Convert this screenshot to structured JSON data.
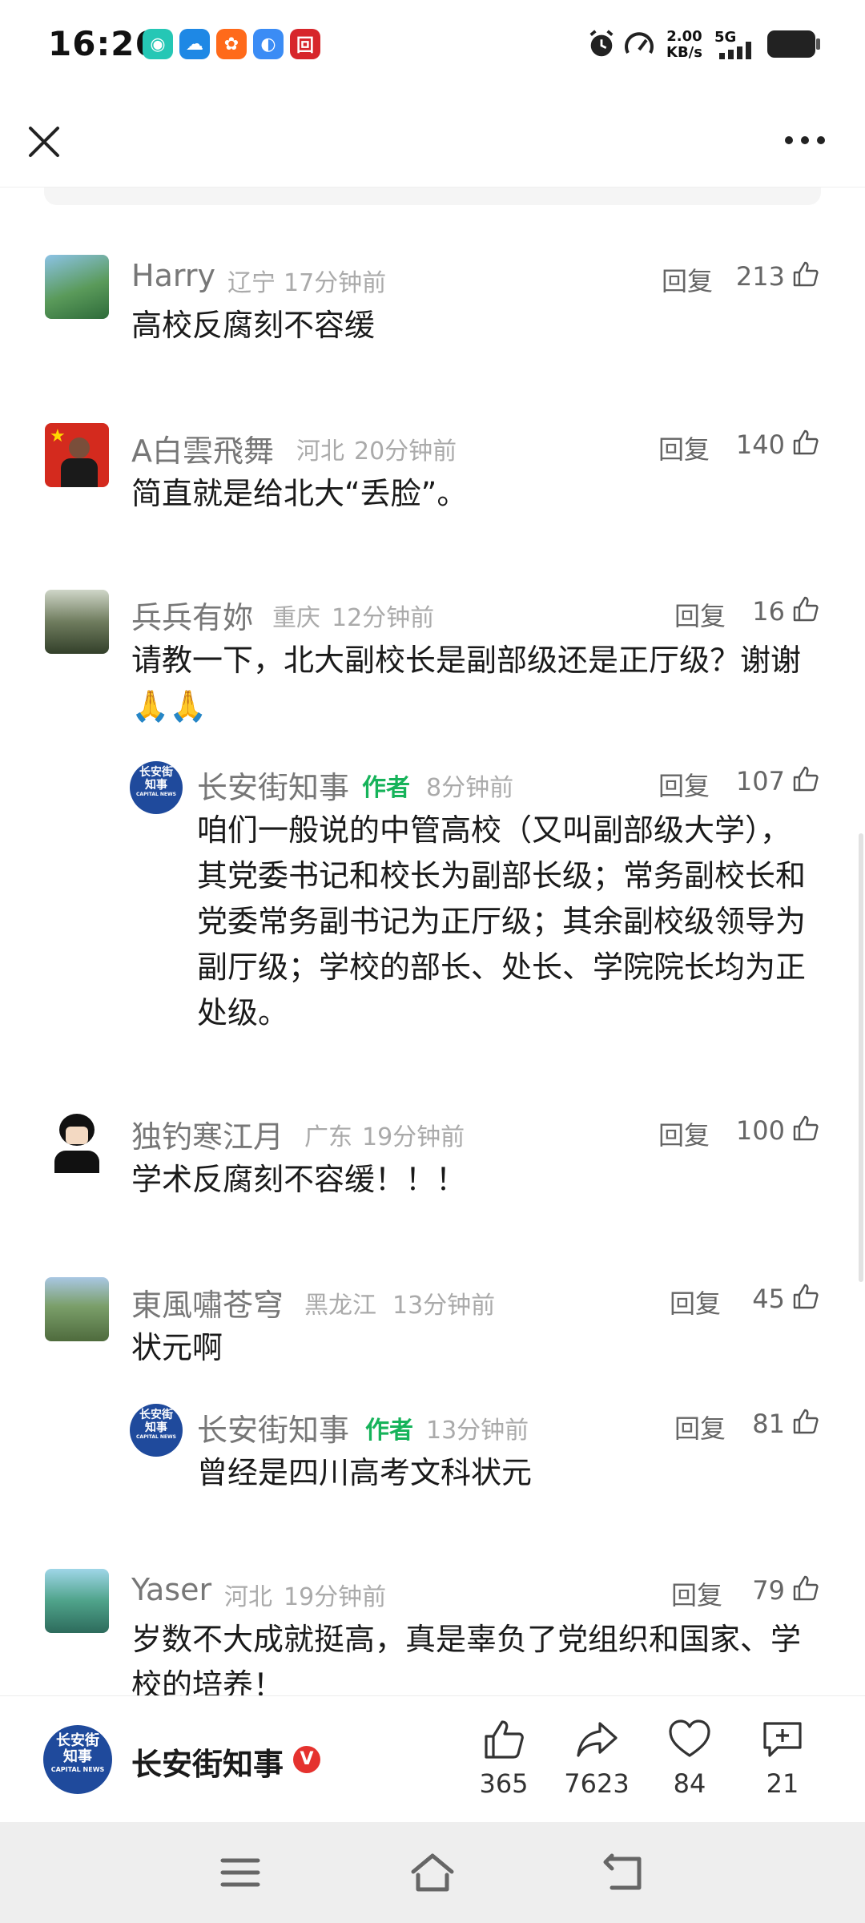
{
  "status_bar": {
    "time": "16:26",
    "speed_value": "2.00",
    "speed_unit": "KB/s",
    "network": "5G"
  },
  "comments": [
    {
      "name": "Harry",
      "location": "辽宁",
      "time": "17分钟前",
      "reply_label": "回复",
      "likes": "213",
      "text": "高校反腐刻不容缓"
    },
    {
      "name": "A白雲飛舞",
      "location": "河北",
      "time": "20分钟前",
      "reply_label": "回复",
      "likes": "140",
      "text": "简直就是给北大“丢脸”。"
    },
    {
      "name": "兵兵有妳",
      "location": "重庆",
      "time": "12分钟前",
      "reply_label": "回复",
      "likes": "16",
      "text": "请教一下，北大副校长是副部级还是正厅级？谢谢🙏🙏"
    },
    {
      "name": "长安街知事",
      "author_tag": "作者",
      "time": "8分钟前",
      "reply_label": "回复",
      "likes": "107",
      "text": "咱们一般说的中管高校（又叫副部级大学），其党委书记和校长为副部长级；常务副校长和党委常务副书记为正厅级；其余副校级领导为副厅级；学校的部长、处长、学院院长均为正处级。"
    },
    {
      "name": "独钓寒江月",
      "location": "广东",
      "time": "19分钟前",
      "reply_label": "回复",
      "likes": "100",
      "text": "学术反腐刻不容缓！！！"
    },
    {
      "name": "東風嘯苍穹",
      "location": "黑龙江",
      "time": "13分钟前",
      "reply_label": "回复",
      "likes": "45",
      "text": "状元啊"
    },
    {
      "name": "长安街知事",
      "author_tag": "作者",
      "time": "13分钟前",
      "reply_label": "回复",
      "likes": "81",
      "text": "曾经是四川高考文科状元"
    },
    {
      "name": "Yaser",
      "location": "河北",
      "time": "19分钟前",
      "reply_label": "回复",
      "likes": "79",
      "text": "岁数不大成就挺高，真是辜负了党组织和国家、学校的培养！"
    }
  ],
  "avatar_logo": {
    "line1": "长安街",
    "line2": "知事",
    "line3": "CAPITAL NEWS"
  },
  "bottom_bar": {
    "account_name": "长安街知事",
    "verified_mark": "V",
    "like_count": "365",
    "share_count": "7623",
    "favorite_count": "84",
    "comment_count": "21"
  },
  "colors": {
    "author_green": "#16b35a",
    "verified_red": "#e5322e",
    "logo_blue": "#1f4a9c"
  }
}
